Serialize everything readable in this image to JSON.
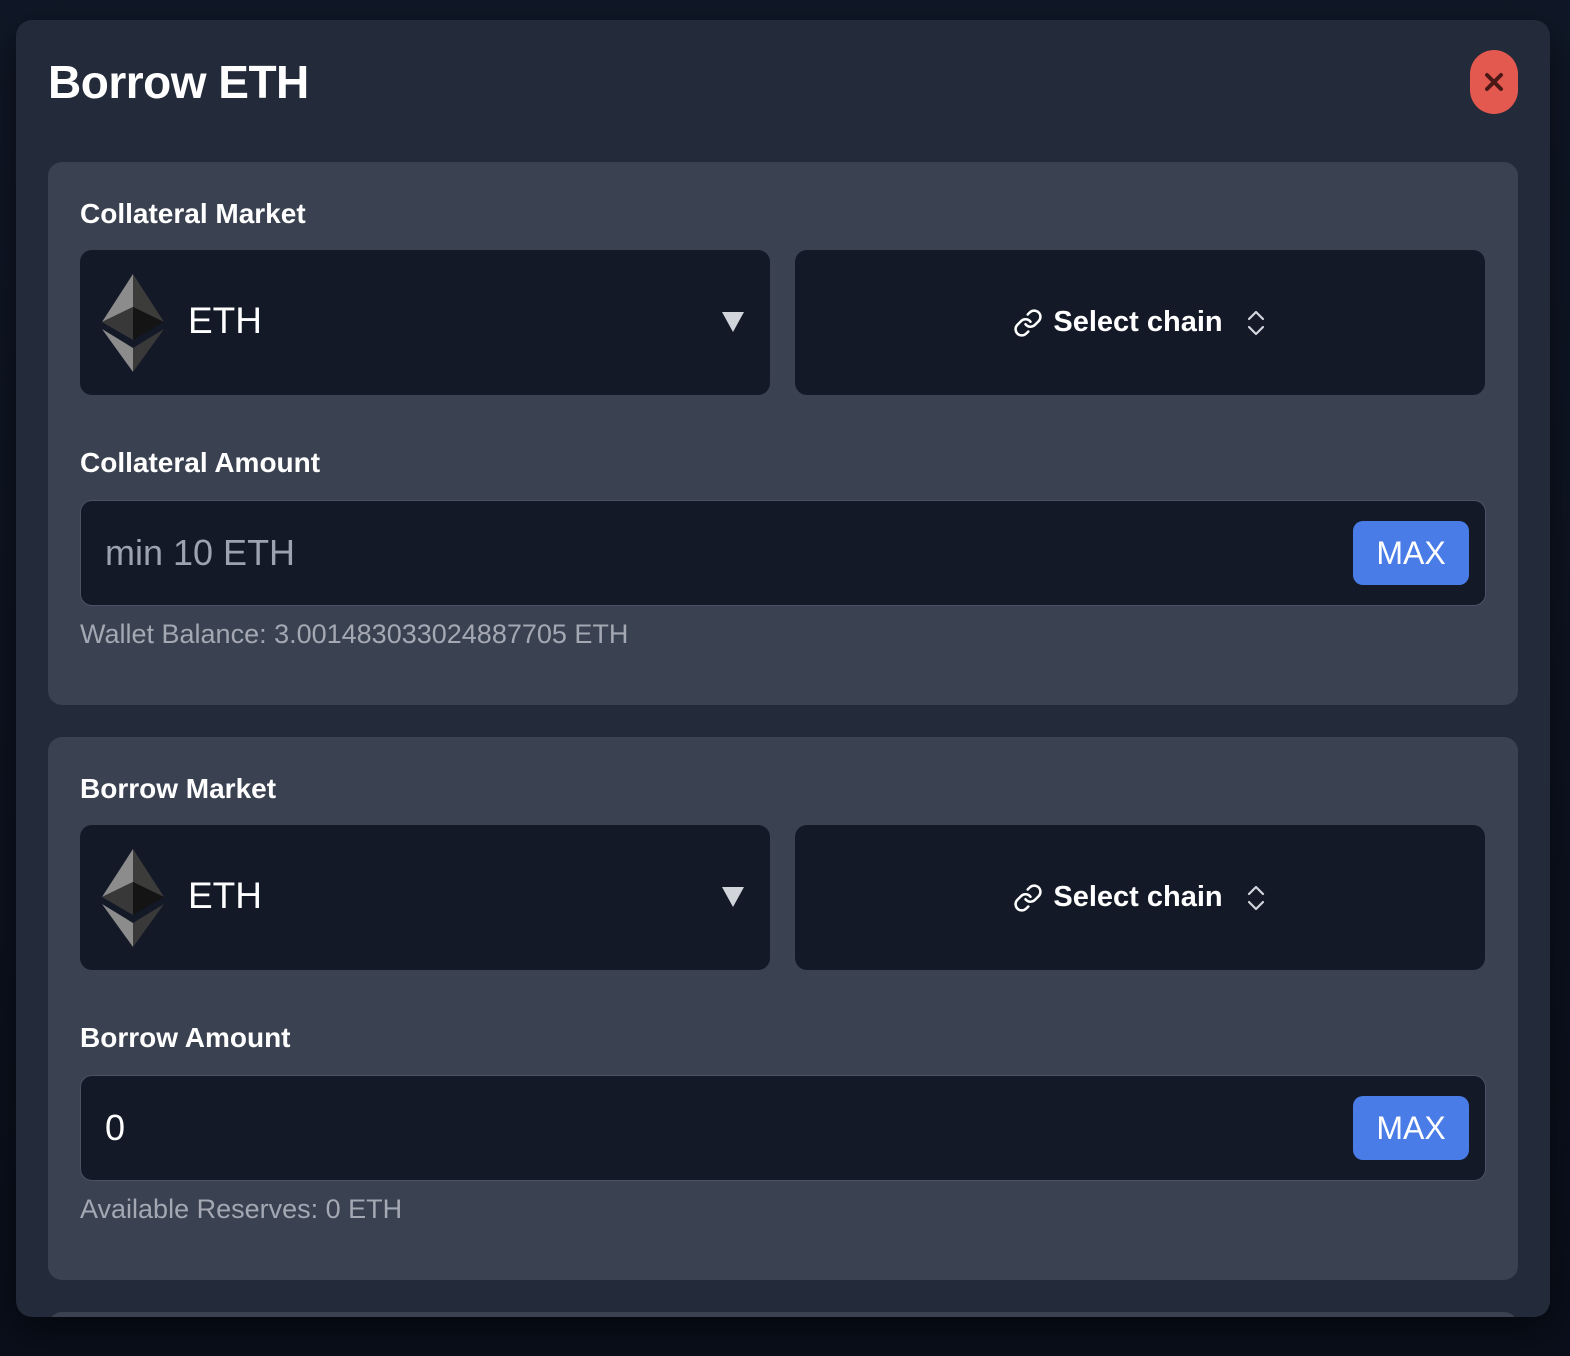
{
  "modal": {
    "title": "Borrow ETH",
    "close_icon": "close-icon"
  },
  "collateral": {
    "market_label": "Collateral Market",
    "asset": "ETH",
    "asset_icon": "ethereum-icon",
    "chain_label": "Select chain",
    "amount_label": "Collateral Amount",
    "amount_value": "",
    "amount_placeholder": "min 10 ETH",
    "max_label": "MAX",
    "helper": "Wallet Balance: 3.001483033024887705 ETH"
  },
  "borrow": {
    "market_label": "Borrow Market",
    "asset": "ETH",
    "asset_icon": "ethereum-icon",
    "chain_label": "Select chain",
    "amount_label": "Borrow Amount",
    "amount_value": "0",
    "amount_placeholder": "",
    "max_label": "MAX",
    "helper": "Available Reserves: 0 ETH"
  },
  "colors": {
    "modal_bg": "#232a39",
    "section_bg": "#3a4150",
    "field_bg": "#131927",
    "accent": "#4a7ce8",
    "close": "#e35950"
  }
}
